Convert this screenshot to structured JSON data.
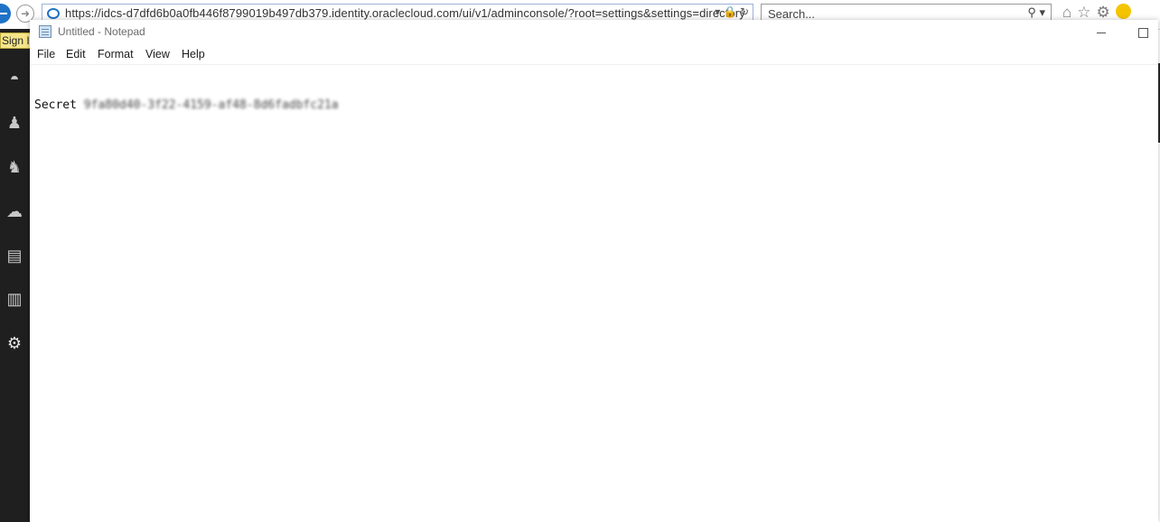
{
  "browser": {
    "address_url": "https://idcs-d7dfd6b0a0fb446f8799019b497db379.identity.oraclecloud.com/ui/v1/adminconsole/?root=settings&settings=directory",
    "address_actions": "▾ 🔒 ↻",
    "search_placeholder": "Search...",
    "search_button": "⚲ ▾",
    "forward_glyph": "➜",
    "toolbar_icons": [
      "home-icon",
      "favorites-star-icon",
      "settings-gear-icon",
      "feedback-smiley-icon"
    ]
  },
  "left_rail": {
    "sign_in_label": "Sign In",
    "icons": [
      "dashboard-icon",
      "user-icon",
      "groups-icon",
      "cloud-icon",
      "applications-icon",
      "reports-icon",
      "settings-gear-icon"
    ]
  },
  "notepad": {
    "title": "Untitled - Notepad",
    "menu": {
      "file": "File",
      "edit": "Edit",
      "format": "Format",
      "view": "View",
      "help": "Help"
    },
    "content": {
      "label": "Secret",
      "value": "9fa80d40-3f22-4159-af48-8d6fadbfc21a"
    }
  },
  "colors": {
    "rail": "#1f1f1f",
    "ie_blue": "#1e73c7",
    "sign_in_tab": "#f6e58a"
  }
}
